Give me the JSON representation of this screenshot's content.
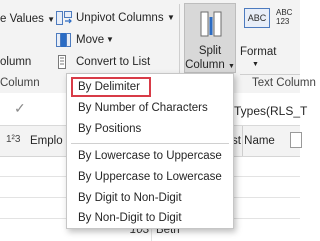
{
  "ribbon": {
    "replace_values_label": "e Values",
    "unpivot_columns_label": "Unpivot Columns",
    "move_label": "Move",
    "convert_to_list_label": "Convert to List",
    "left_column_label": "olumn",
    "group_any_column": "Column",
    "split_column_line1": "Split",
    "split_column_line2": "Column",
    "format_label": "Format",
    "abc_badge": "ABC",
    "abc_digits": "123",
    "text_column_group": "Text Column"
  },
  "formula_bar": {
    "formula_text": "Types(RLS_T"
  },
  "grid": {
    "col_type_icon": "1²3",
    "col1_header": "Emplo",
    "col2_header": "st Name",
    "row_value": "103",
    "row_name": "Beth"
  },
  "split_menu": {
    "items": [
      "By Delimiter",
      "By Number of Characters",
      "By Positions",
      "By Lowercase to Uppercase",
      "By Uppercase to Lowercase",
      "By Digit to Non-Digit",
      "By Non-Digit to Digit"
    ],
    "highlighted_index": 0
  },
  "colors": {
    "ribbon_bg": "#f3f3f3",
    "split_button_bg": "#d8d8d8",
    "highlight_border": "#d83b47",
    "icon_blue": "#2b6cc4"
  }
}
